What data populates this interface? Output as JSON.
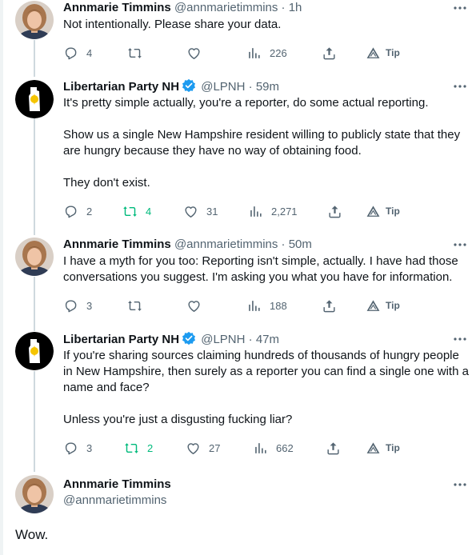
{
  "tweets": [
    {
      "name": "Annmarie Timmins",
      "handle": "@annmarietimmins",
      "separator": "·",
      "time": "1h",
      "avatar": "annmarie-photo",
      "verified": false,
      "paragraphs": [
        "Not intentionally. Please share your data."
      ],
      "replies": "4",
      "retweets": "",
      "likes": "",
      "views": "226",
      "tip": "Tip",
      "retweeted": false
    },
    {
      "name": "Libertarian Party NH",
      "handle": "@LPNH",
      "separator": "·",
      "time": "59m",
      "avatar": "lpnh-logo",
      "verified": true,
      "paragraphs": [
        "It's pretty simple actually, you're a reporter, do some actual reporting.",
        "Show us a single New Hampshire resident willing to publicly state that they are hungry because they have no way of obtaining food.",
        "They don't exist."
      ],
      "replies": "2",
      "retweets": "4",
      "likes": "31",
      "views": "2,271",
      "tip": "Tip",
      "retweeted": true
    },
    {
      "name": "Annmarie Timmins",
      "handle": "@annmarietimmins",
      "separator": "·",
      "time": "50m",
      "avatar": "annmarie-photo",
      "verified": false,
      "paragraphs": [
        "I have a myth for you too: Reporting isn't simple, actually. I have had those conversations you suggest. I'm asking you what you have for information."
      ],
      "replies": "3",
      "retweets": "",
      "likes": "",
      "views": "188",
      "tip": "Tip",
      "retweeted": false
    },
    {
      "name": "Libertarian Party NH",
      "handle": "@LPNH",
      "separator": "·",
      "time": "47m",
      "avatar": "lpnh-logo",
      "verified": true,
      "paragraphs": [
        "If you're sharing sources claiming hundreds of thousands of hungry people in New Hampshire, then surely as a reporter you can find a single one with a name and face?",
        "Unless you're just a disgusting fucking liar?"
      ],
      "replies": "3",
      "retweets": "2",
      "likes": "27",
      "views": "662",
      "tip": "Tip",
      "retweeted": true
    }
  ],
  "main_tweet": {
    "name": "Annmarie Timmins",
    "handle": "@annmarietimmins",
    "text": "Wow."
  },
  "icons": {
    "reply": "reply-icon",
    "retweet": "retweet-icon",
    "like": "heart-icon",
    "views": "views-icon",
    "share": "share-icon",
    "tip": "tip-icon",
    "more": "more-icon",
    "verified": "verified-badge-icon"
  },
  "colors": {
    "text": "#0f1419",
    "secondary": "#536471",
    "verified": "#1d9bf0",
    "retweet_active": "#00ba7c",
    "thread_line": "#cfd9de",
    "lpnh_gold": "#f5c400"
  }
}
